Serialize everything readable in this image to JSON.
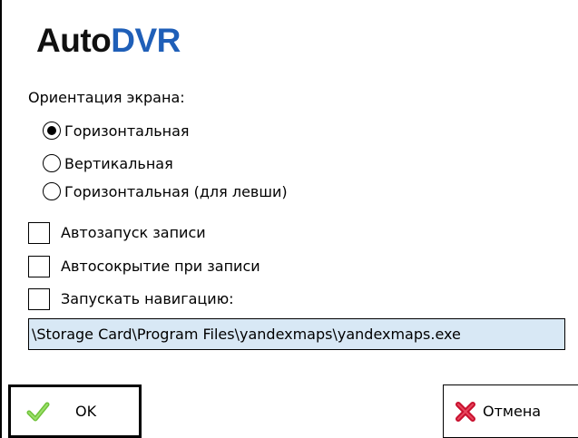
{
  "app": {
    "logo_part1": "Auto",
    "logo_part2": "DVR"
  },
  "orientation": {
    "label": "Ориентация экрана:",
    "options": [
      {
        "label": "Горизонтальная",
        "selected": true
      },
      {
        "label": "Вертикальная",
        "selected": false
      },
      {
        "label": "Горизонтальная (для левши)",
        "selected": false
      }
    ]
  },
  "options": {
    "autostart": {
      "label": "Автозапуск записи",
      "checked": false
    },
    "autohide": {
      "label": "Автосокрытие при записи",
      "checked": false
    },
    "navigation": {
      "label": "Запускать навигацию:",
      "checked": false
    }
  },
  "navigation_path": "\\Storage Card\\Program Files\\yandexmaps\\yandexmaps.exe",
  "buttons": {
    "ok": "OK",
    "cancel": "Отмена"
  },
  "colors": {
    "logo_accent": "#1f5fb8",
    "field_bg": "#d8e8f5",
    "ok_icon": "#6fc23a",
    "cancel_icon": "#c8102e"
  },
  "icons": {
    "ok": "checkmark-icon",
    "cancel": "x-mark-icon"
  }
}
